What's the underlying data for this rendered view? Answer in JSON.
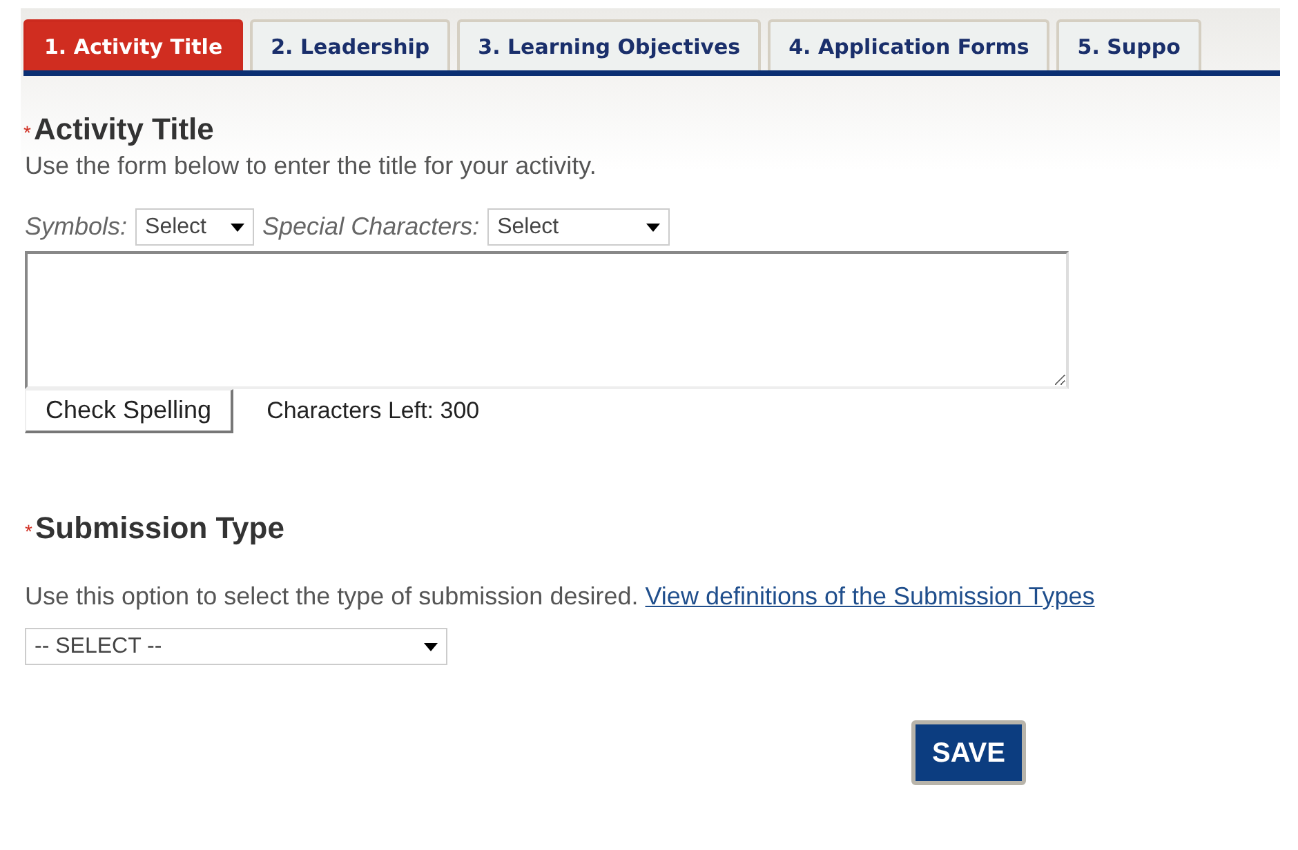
{
  "tabs": [
    {
      "label": "1. Activity Title",
      "selected": true
    },
    {
      "label": "2. Leadership",
      "selected": false
    },
    {
      "label": "3. Learning Objectives",
      "selected": false
    },
    {
      "label": "4. Application Forms",
      "selected": false
    },
    {
      "label": "5. Suppo",
      "selected": false
    }
  ],
  "title_section": {
    "required_mark": "*",
    "heading": "Activity Title",
    "instructions": "Use the form below to enter the title for your activity.",
    "symbols": {
      "label": "Symbols:",
      "value": "Select"
    },
    "special_characters": {
      "label": "Special Characters:",
      "value": "Select"
    },
    "spell_button": "Check Spelling",
    "characters_left": "Characters Left: 300"
  },
  "submission_section": {
    "required_mark": "*",
    "heading": "Submission Type",
    "instructions": "Use this option to select the type of submission desired.",
    "link": "View definitions of the Submission Types",
    "select_value": "-- SELECT --"
  },
  "save_button": "SAVE"
}
